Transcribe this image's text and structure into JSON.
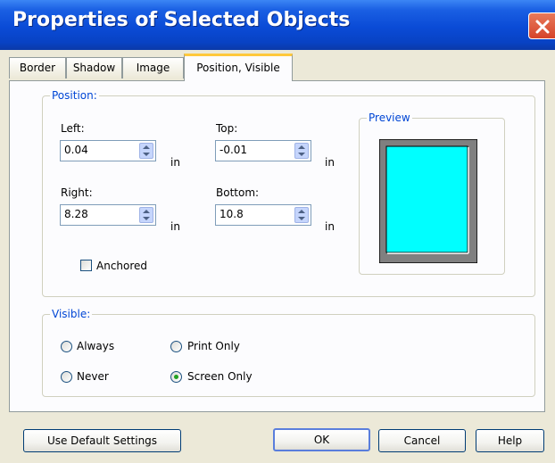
{
  "window": {
    "title": "Properties of Selected Objects",
    "close_icon": "close-icon"
  },
  "tabs": [
    {
      "label": "Border",
      "active": false
    },
    {
      "label": "Shadow",
      "active": false
    },
    {
      "label": "Image",
      "active": false
    },
    {
      "label": "Position, Visible",
      "active": true
    }
  ],
  "position": {
    "group_label": "Position:",
    "left": {
      "label": "Left:",
      "value": "0.04",
      "unit": "in"
    },
    "top": {
      "label": "Top:",
      "value": "-0.01",
      "unit": "in"
    },
    "right": {
      "label": "Right:",
      "value": "8.28",
      "unit": "in"
    },
    "bottom": {
      "label": "Bottom:",
      "value": "10.8",
      "unit": "in"
    },
    "anchored": {
      "label": "Anchored",
      "checked": false
    }
  },
  "preview": {
    "label": "Preview",
    "page_color": "#00ffff",
    "frame_color": "#808080"
  },
  "visible": {
    "group_label": "Visible:",
    "options": [
      {
        "label": "Always",
        "selected": false
      },
      {
        "label": "Print Only",
        "selected": false
      },
      {
        "label": "Never",
        "selected": false
      },
      {
        "label": "Screen Only",
        "selected": true
      }
    ]
  },
  "buttons": {
    "defaults": "Use Default Settings",
    "ok": "OK",
    "cancel": "Cancel",
    "help": "Help"
  }
}
